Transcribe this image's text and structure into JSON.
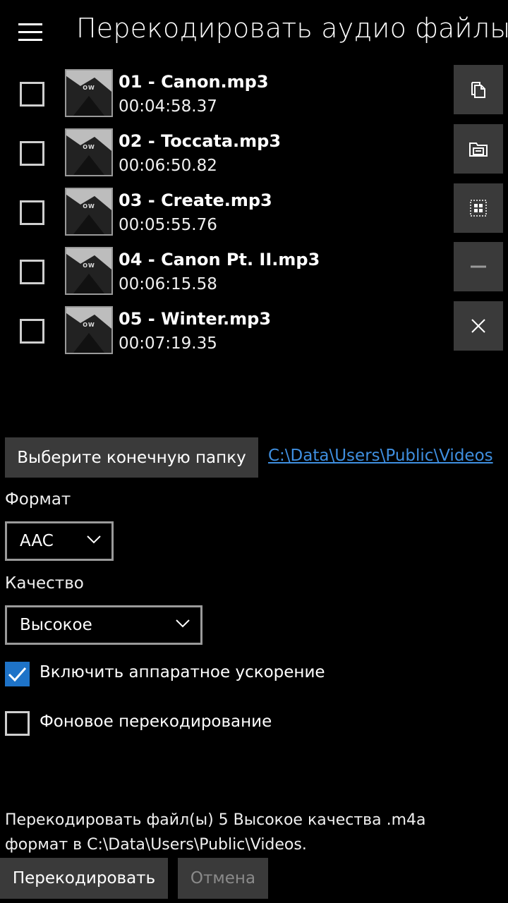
{
  "header": {
    "title": "Перекодировать аудио файлы",
    "menu_icon": "hamburger-icon"
  },
  "files": [
    {
      "name": "01 - Canon.mp3",
      "duration": "00:04:58.37",
      "checked": false,
      "thumb_text": "OW"
    },
    {
      "name": "02 - Toccata.mp3",
      "duration": "00:06:50.82",
      "checked": false,
      "thumb_text": "OW"
    },
    {
      "name": "03 - Create.mp3",
      "duration": "00:05:55.76",
      "checked": false,
      "thumb_text": "OW"
    },
    {
      "name": "04 - Canon Pt. II.mp3",
      "duration": "00:06:15.58",
      "checked": false,
      "thumb_text": "OW"
    },
    {
      "name": "05 - Winter.mp3",
      "duration": "00:07:19.35",
      "checked": false,
      "thumb_text": "OW"
    }
  ],
  "toolbar": {
    "icons": [
      "copy-icon",
      "open-folder-icon",
      "select-all-icon",
      "remove-icon",
      "clear-icon"
    ]
  },
  "folder": {
    "button_label": "Выберите конечную папку",
    "path": "C:\\Data\\Users\\Public\\Videos"
  },
  "format": {
    "label": "Формат",
    "value": "AAC"
  },
  "quality": {
    "label": "Качество",
    "value": "Высокое"
  },
  "options": {
    "hw_accel_label": "Включить аппаратное ускорение",
    "hw_accel_checked": true,
    "background_label": "Фоновое перекодирование",
    "background_checked": false
  },
  "summary": {
    "line1": "Перекодировать файл(ы) 5 Высокое качества .m4a",
    "line2": "формат в C:\\Data\\Users\\Public\\Videos."
  },
  "actions": {
    "transcode_label": "Перекодировать",
    "cancel_label": "Отмена"
  },
  "colors": {
    "accent": "#1e73c8",
    "link": "#3f8fe0",
    "button_bg": "#3a3a3a",
    "disabled_text": "#8a8a8a"
  }
}
